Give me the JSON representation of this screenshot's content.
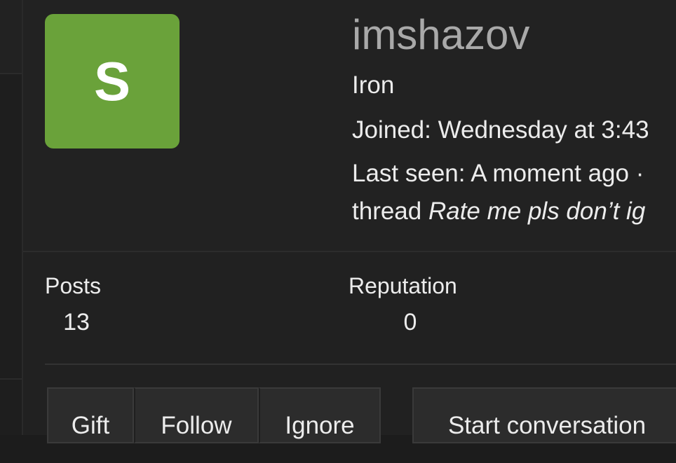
{
  "profile": {
    "avatar_letter": "S",
    "avatar_color": "#6aa23a",
    "username": "imshazov",
    "rank": "Iron",
    "joined": "Joined: Wednesday at 3:43",
    "last_seen": "Last seen: A moment ago ·",
    "thread_prefix": "thread ",
    "thread_title": "Rate me pls don’t ig"
  },
  "stats": {
    "posts_label": "Posts",
    "posts_value": "13",
    "reputation_label": "Reputation",
    "reputation_value": "0"
  },
  "actions": {
    "gift": "Gift",
    "follow": "Follow",
    "ignore": "Ignore",
    "start_conversation": "Start conversation"
  }
}
